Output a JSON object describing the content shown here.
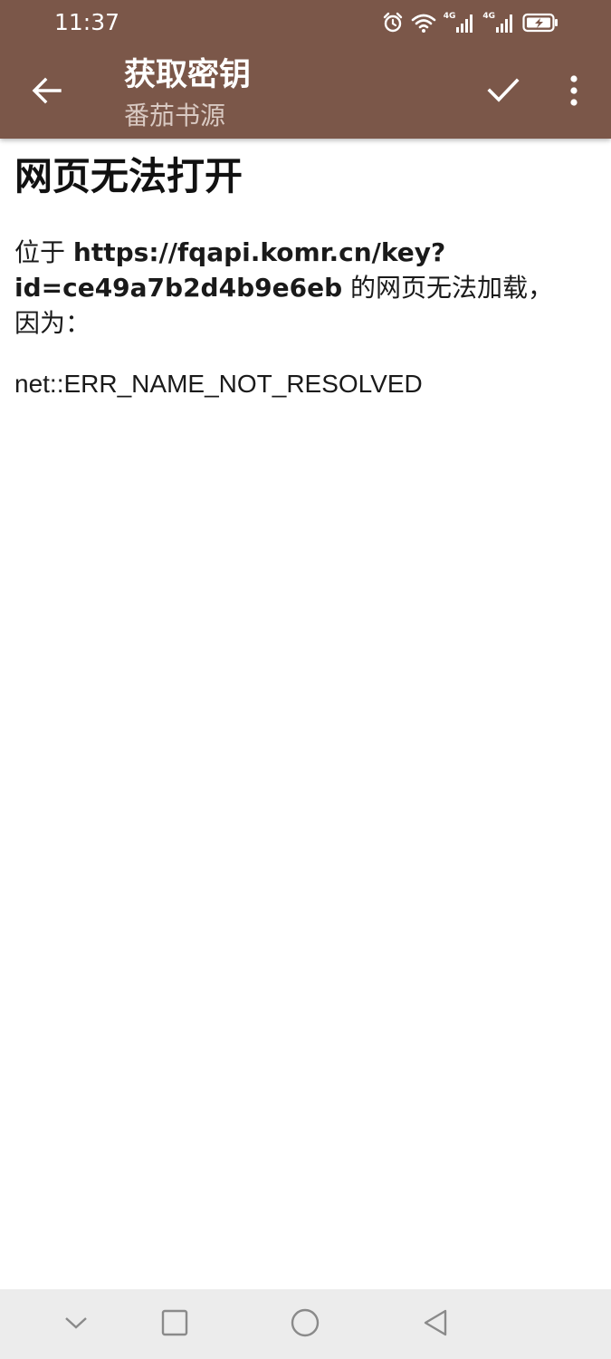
{
  "status_bar": {
    "time": "11:37",
    "icons": [
      "alarm-icon",
      "wifi-icon",
      "signal-4g-icon",
      "signal-4g-icon",
      "battery-charging-icon"
    ],
    "network_label_1": "4G",
    "network_label_2": "4G"
  },
  "app_bar": {
    "title": "获取密钥",
    "subtitle": "番茄书源",
    "background_color": "#7b5749",
    "back_icon": "arrow-left-icon",
    "confirm_icon": "check-icon",
    "menu_icon": "more-vertical-icon"
  },
  "error_page": {
    "heading": "网页无法打开",
    "message_prefix": "位于 ",
    "url": "https://fqapi.komr.cn/key?id=ce49a7b2d4b9e6eb",
    "message_suffix": " 的网页无法加载，因为：",
    "error_code": "net::ERR_NAME_NOT_RESOLVED"
  },
  "nav_bar": {
    "icons": [
      "chevron-down-icon",
      "square-icon",
      "circle-icon",
      "triangle-back-icon"
    ]
  }
}
